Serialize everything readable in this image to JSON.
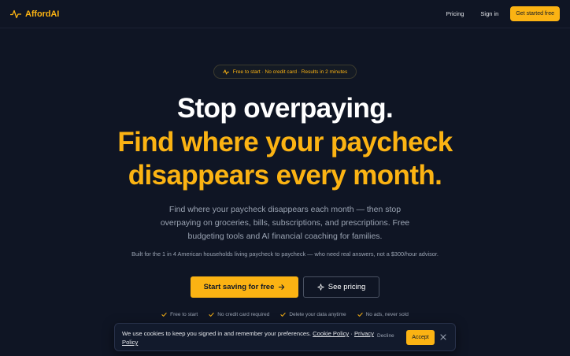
{
  "brand": {
    "name": "AffordAI",
    "icon": "pulse-icon",
    "accent": "#fbb313"
  },
  "nav": {
    "pricing": "Pricing",
    "signin": "Sign in",
    "cta": "Get started free"
  },
  "hero": {
    "pill": "Free to start · No credit card · Results in 2 minutes",
    "headline_line1": "Stop overpaying.",
    "headline_line2": "Find where your paycheck",
    "headline_line3": "disappears every month.",
    "subheading": "Find where your paycheck disappears each month — then stop overpaying on groceries, bills, subscriptions, and prescriptions. Free budgeting tools and AI financial coaching for families.",
    "note": "Built for the 1 in 4 American households living paycheck to paycheck — who need real answers, not a $300/hour advisor.",
    "primary_cta": "Start saving for free",
    "secondary_cta": "See pricing"
  },
  "features": [
    "Free to start",
    "No credit card required",
    "Delete your data anytime",
    "No ads, never sold"
  ],
  "cookie": {
    "text": "We use cookies to keep you signed in and remember your preferences.",
    "cookie_policy": "Cookie Policy",
    "separator": "·",
    "privacy_policy": "Privacy Policy",
    "decline": "Decline",
    "accept": "Accept"
  },
  "colors": {
    "background": "#0f1524",
    "accent": "#fbb313",
    "muted_text": "#9aa3b2"
  }
}
